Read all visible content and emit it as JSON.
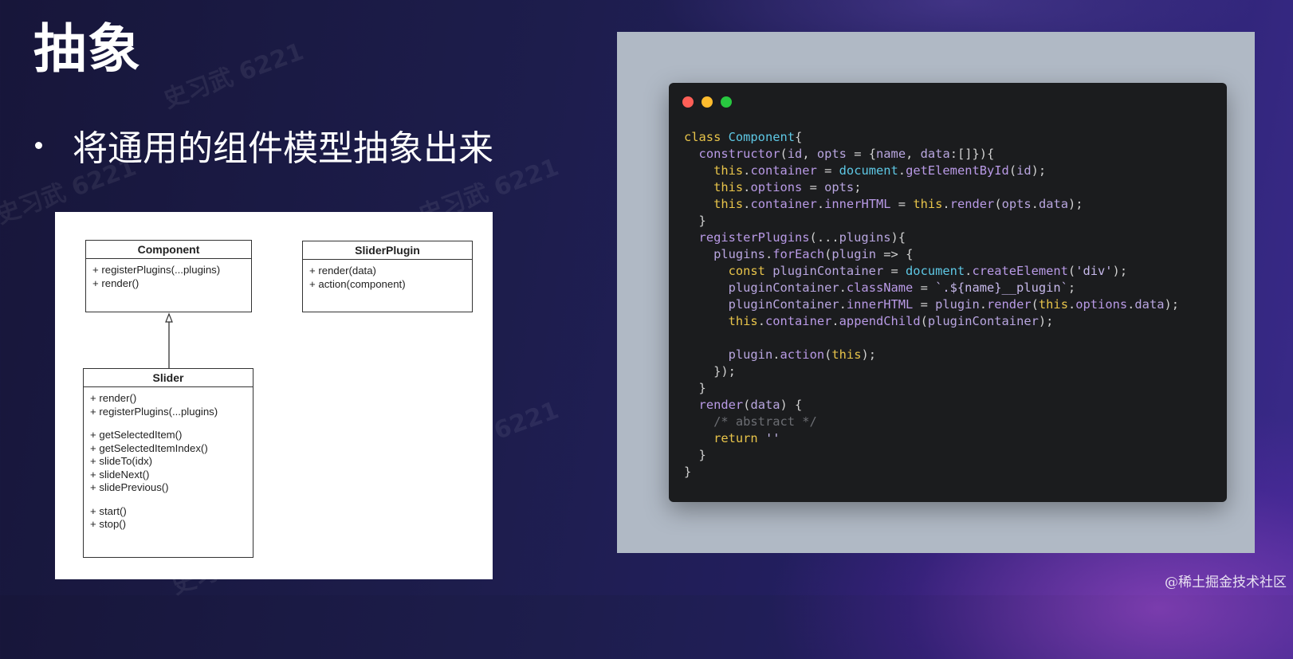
{
  "slide": {
    "title": "抽象",
    "bullet": "将通用的组件模型抽象出来",
    "watermark": "史习武 6221",
    "credit": "@稀土掘金技术社区"
  },
  "uml": {
    "component": {
      "name": "Component",
      "methods": [
        "+ registerPlugins(...plugins)",
        "+ render()"
      ]
    },
    "slider_plugin": {
      "name": "SliderPlugin",
      "methods": [
        "+ render(data)",
        "+ action(component)"
      ]
    },
    "slider": {
      "name": "Slider",
      "groups": [
        [
          "+ render()",
          "+ registerPlugins(...plugins)"
        ],
        [
          "+ getSelectedItem()",
          "+ getSelectedItemIndex()",
          "+ slideTo(idx)",
          "+ slideNext()",
          "+ slidePrevious()"
        ],
        [
          "+ start()",
          "+ stop()"
        ]
      ]
    }
  },
  "code_window": {
    "traffic_lights": [
      "#ff5f57",
      "#febc2e",
      "#28c840"
    ],
    "lines": [
      [
        [
          "kw",
          "class "
        ],
        [
          "cls",
          "Component"
        ],
        [
          "op",
          "{"
        ]
      ],
      [
        [
          "op",
          "  "
        ],
        [
          "fn",
          "constructor"
        ],
        [
          "op",
          "("
        ],
        [
          "var",
          "id"
        ],
        [
          "op",
          ", "
        ],
        [
          "var",
          "opts"
        ],
        [
          "op",
          " = {"
        ],
        [
          "var",
          "name"
        ],
        [
          "op",
          ", "
        ],
        [
          "var",
          "data"
        ],
        [
          "op",
          ":[]}){"
        ]
      ],
      [
        [
          "op",
          "    "
        ],
        [
          "this",
          "this"
        ],
        [
          "op",
          "."
        ],
        [
          "fn",
          "container"
        ],
        [
          "op",
          " = "
        ],
        [
          "cls",
          "document"
        ],
        [
          "op",
          "."
        ],
        [
          "fn",
          "getElementById"
        ],
        [
          "op",
          "("
        ],
        [
          "var",
          "id"
        ],
        [
          "op",
          ");"
        ]
      ],
      [
        [
          "op",
          "    "
        ],
        [
          "this",
          "this"
        ],
        [
          "op",
          "."
        ],
        [
          "fn",
          "options"
        ],
        [
          "op",
          " = "
        ],
        [
          "var",
          "opts"
        ],
        [
          "op",
          ";"
        ]
      ],
      [
        [
          "op",
          "    "
        ],
        [
          "this",
          "this"
        ],
        [
          "op",
          "."
        ],
        [
          "fn",
          "container"
        ],
        [
          "op",
          "."
        ],
        [
          "fn",
          "innerHTML"
        ],
        [
          "op",
          " = "
        ],
        [
          "this",
          "this"
        ],
        [
          "op",
          "."
        ],
        [
          "fn",
          "render"
        ],
        [
          "op",
          "("
        ],
        [
          "var",
          "opts"
        ],
        [
          "op",
          "."
        ],
        [
          "var",
          "data"
        ],
        [
          "op",
          ");"
        ]
      ],
      [
        [
          "op",
          "  }"
        ]
      ],
      [
        [
          "op",
          "  "
        ],
        [
          "fn",
          "registerPlugins"
        ],
        [
          "op",
          "(..."
        ],
        [
          "var",
          "plugins"
        ],
        [
          "op",
          "){"
        ]
      ],
      [
        [
          "op",
          "    "
        ],
        [
          "var",
          "plugins"
        ],
        [
          "op",
          "."
        ],
        [
          "fn",
          "forEach"
        ],
        [
          "op",
          "("
        ],
        [
          "var",
          "plugin"
        ],
        [
          "op",
          " => {"
        ]
      ],
      [
        [
          "op",
          "      "
        ],
        [
          "kw",
          "const "
        ],
        [
          "var",
          "pluginContainer"
        ],
        [
          "op",
          " = "
        ],
        [
          "cls",
          "document"
        ],
        [
          "op",
          "."
        ],
        [
          "fn",
          "createElement"
        ],
        [
          "op",
          "("
        ],
        [
          "str",
          "'div'"
        ],
        [
          "op",
          ");"
        ]
      ],
      [
        [
          "op",
          "      "
        ],
        [
          "var",
          "pluginContainer"
        ],
        [
          "op",
          "."
        ],
        [
          "fn",
          "className"
        ],
        [
          "op",
          " = "
        ],
        [
          "str",
          "`.${name}__plugin`"
        ],
        [
          "op",
          ";"
        ]
      ],
      [
        [
          "op",
          "      "
        ],
        [
          "var",
          "pluginContainer"
        ],
        [
          "op",
          "."
        ],
        [
          "fn",
          "innerHTML"
        ],
        [
          "op",
          " = "
        ],
        [
          "var",
          "plugin"
        ],
        [
          "op",
          "."
        ],
        [
          "fn",
          "render"
        ],
        [
          "op",
          "("
        ],
        [
          "this",
          "this"
        ],
        [
          "op",
          "."
        ],
        [
          "fn",
          "options"
        ],
        [
          "op",
          "."
        ],
        [
          "var",
          "data"
        ],
        [
          "op",
          ");"
        ]
      ],
      [
        [
          "op",
          "      "
        ],
        [
          "this",
          "this"
        ],
        [
          "op",
          "."
        ],
        [
          "fn",
          "container"
        ],
        [
          "op",
          "."
        ],
        [
          "fn",
          "appendChild"
        ],
        [
          "op",
          "("
        ],
        [
          "var",
          "pluginContainer"
        ],
        [
          "op",
          ");"
        ]
      ],
      [
        [
          "op",
          ""
        ]
      ],
      [
        [
          "op",
          "      "
        ],
        [
          "var",
          "plugin"
        ],
        [
          "op",
          "."
        ],
        [
          "fn",
          "action"
        ],
        [
          "op",
          "("
        ],
        [
          "this",
          "this"
        ],
        [
          "op",
          ");"
        ]
      ],
      [
        [
          "op",
          "    });"
        ]
      ],
      [
        [
          "op",
          "  }"
        ]
      ],
      [
        [
          "op",
          "  "
        ],
        [
          "fn",
          "render"
        ],
        [
          "op",
          "("
        ],
        [
          "var",
          "data"
        ],
        [
          "op",
          ") {"
        ]
      ],
      [
        [
          "op",
          "    "
        ],
        [
          "cm",
          "/* abstract */"
        ]
      ],
      [
        [
          "op",
          "    "
        ],
        [
          "kw",
          "return "
        ],
        [
          "str",
          "''"
        ]
      ],
      [
        [
          "op",
          "  }"
        ]
      ],
      [
        [
          "op",
          "}"
        ]
      ]
    ]
  }
}
